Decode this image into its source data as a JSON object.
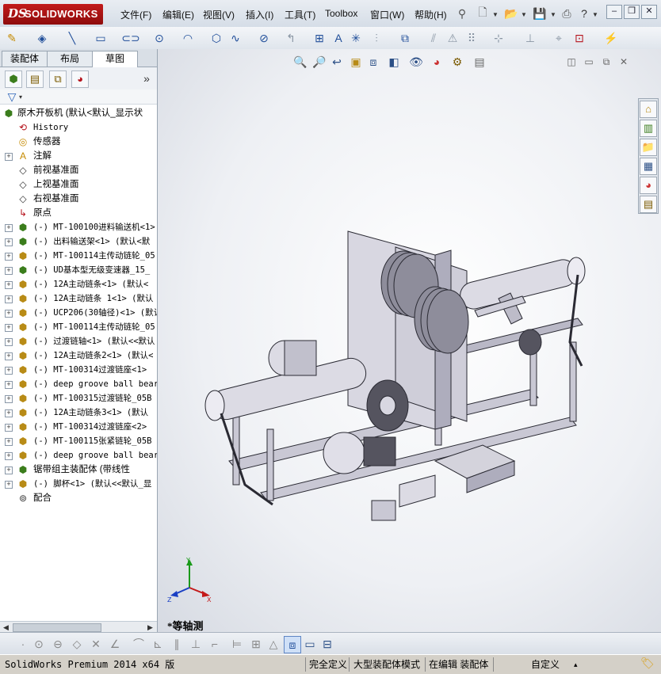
{
  "app": {
    "logo_ds": "DS",
    "logo_text": "SOLIDWORKS"
  },
  "menu": {
    "items": [
      "文件(F)",
      "编辑(E)",
      "视图(V)",
      "插入(I)",
      "工具(T)",
      "Toolbox",
      "窗口(W)",
      "帮助(H)"
    ]
  },
  "tabs": [
    "装配体",
    "布局",
    "草图"
  ],
  "active_tab": "草图",
  "tree": {
    "root_label": "原木开板机  (默认<默认_显示状",
    "items": [
      {
        "label": "History",
        "icon": "history-icon",
        "mono": true,
        "expand": false
      },
      {
        "label": "传感器",
        "icon": "sensor-icon",
        "mono": false,
        "expand": false
      },
      {
        "label": "注解",
        "icon": "annotation-icon",
        "mono": false,
        "expand": true
      },
      {
        "label": "前视基准面",
        "icon": "plane-icon",
        "mono": false,
        "expand": false
      },
      {
        "label": "上视基准面",
        "icon": "plane-icon",
        "mono": false,
        "expand": false
      },
      {
        "label": "右视基准面",
        "icon": "plane-icon",
        "mono": false,
        "expand": false
      },
      {
        "label": "原点",
        "icon": "origin-icon",
        "mono": false,
        "expand": false
      },
      {
        "label": "(-) MT-100100进料输送机<1>",
        "icon": "assembly-icon",
        "mono": true,
        "expand": true
      },
      {
        "label": "(-) 出料输送架<1> (默认<默",
        "icon": "assembly-icon",
        "mono": true,
        "expand": true
      },
      {
        "label": "(-) MT-100114主传动链轮_05",
        "icon": "part-icon",
        "mono": true,
        "expand": true
      },
      {
        "label": "(-) UD基本型无级变速器_15_",
        "icon": "assembly-icon",
        "mono": true,
        "expand": true
      },
      {
        "label": "(-) 12A主动链条<1> (默认<",
        "icon": "part-icon",
        "mono": true,
        "expand": true
      },
      {
        "label": "(-) 12A主动链条 1<1> (默认",
        "icon": "part-icon",
        "mono": true,
        "expand": true
      },
      {
        "label": "(-) UCP206(30轴径)<1> (默认",
        "icon": "part-icon",
        "mono": true,
        "expand": true
      },
      {
        "label": "(-) MT-100114主传动链轮_05",
        "icon": "part-icon",
        "mono": true,
        "expand": true
      },
      {
        "label": "(-) 过渡链轴<1> (默认<<默认",
        "icon": "part-icon",
        "mono": true,
        "expand": true
      },
      {
        "label": "(-) 12A主动链条2<1> (默认<",
        "icon": "part-icon",
        "mono": true,
        "expand": true
      },
      {
        "label": "(-) MT-100314过渡链座<1>",
        "icon": "part-icon",
        "mono": true,
        "expand": true
      },
      {
        "label": "(-) deep groove ball bear",
        "icon": "part-icon",
        "mono": true,
        "expand": true
      },
      {
        "label": "(-) MT-100315过渡链轮_05B",
        "icon": "part-icon",
        "mono": true,
        "expand": true
      },
      {
        "label": "(-) 12A主动链条3<1> (默认",
        "icon": "part-icon",
        "mono": true,
        "expand": true
      },
      {
        "label": "(-) MT-100314过渡链座<2>",
        "icon": "part-icon",
        "mono": true,
        "expand": true
      },
      {
        "label": "(-) MT-100115张紧链轮_05B",
        "icon": "part-icon",
        "mono": true,
        "expand": true
      },
      {
        "label": "(-) deep groove ball bear",
        "icon": "part-icon",
        "mono": true,
        "expand": true
      },
      {
        "label": "锯带组主装配体 (带线性",
        "icon": "assembly-icon",
        "mono": false,
        "expand": true
      },
      {
        "label": "(-) 脚杯<1> (默认<<默认_显",
        "icon": "part-icon",
        "mono": true,
        "expand": true
      },
      {
        "label": "配合",
        "icon": "mates-icon",
        "mono": false,
        "expand": false
      }
    ]
  },
  "viewport": {
    "view_label": "*等轴测",
    "triad": {
      "x": "X",
      "y": "Y",
      "z": "Z"
    }
  },
  "status": {
    "version": "SolidWorks Premium 2014 x64 版",
    "fully_defined": "完全定义",
    "large_assembly": "大型装配体模式",
    "editing": "在编辑 装配体",
    "custom": "自定义",
    "caret": "▴"
  },
  "colors": {
    "accent_red": "#b5121b",
    "model_gray": "#c9c8d4"
  }
}
